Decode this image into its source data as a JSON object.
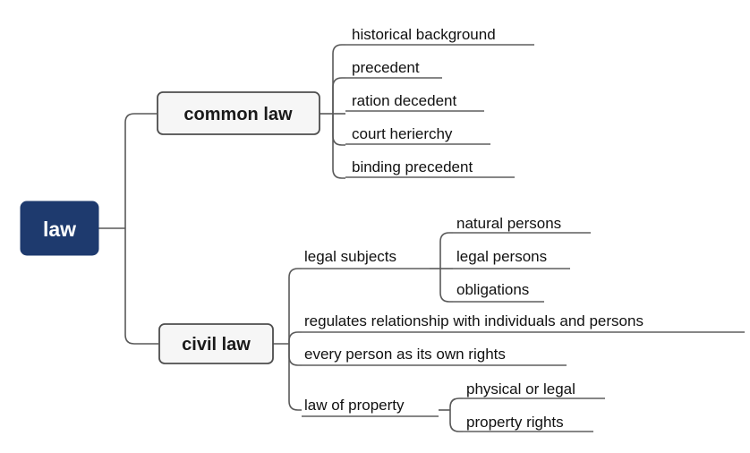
{
  "diagram": {
    "title": "law",
    "type": "mind-map",
    "colors": {
      "root_fill": "#1e3a6e",
      "root_text": "#ffffff",
      "branch_fill": "#f6f6f6",
      "branch_border": "#4d4d4d",
      "connector": "#595959",
      "leaf_text": "#111111",
      "background": "#ffffff"
    }
  },
  "root": {
    "label": "law"
  },
  "branches": [
    {
      "label": "common law",
      "children": [
        {
          "label": "historical background"
        },
        {
          "label": "precedent"
        },
        {
          "label": "ration decedent"
        },
        {
          "label": "court herierchy"
        },
        {
          "label": "binding precedent"
        }
      ]
    },
    {
      "label": "civil law",
      "children": [
        {
          "label": "legal subjects",
          "children": [
            {
              "label": "natural persons"
            },
            {
              "label": "legal persons"
            },
            {
              "label": "obligations"
            }
          ]
        },
        {
          "label": "regulates relationship with individuals and persons"
        },
        {
          "label": "every person as its own rights"
        },
        {
          "label": "law of property",
          "children": [
            {
              "label": "physical or legal"
            },
            {
              "label": "property rights"
            }
          ]
        }
      ]
    }
  ]
}
